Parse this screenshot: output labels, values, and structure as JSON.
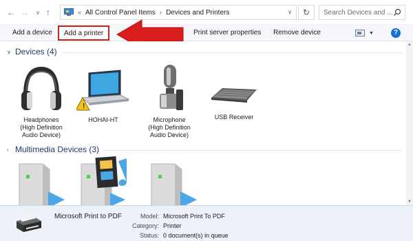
{
  "address_bar": {
    "crumbs": [
      "All Control Panel Items",
      "Devices and Printers"
    ],
    "separator": "«",
    "search_placeholder": "Search Devices and ..."
  },
  "command_bar": {
    "add_device": "Add a device",
    "add_printer": "Add a printer",
    "print_server": "Print server properties",
    "remove_device": "Remove device",
    "help": "?"
  },
  "groups": {
    "devices": {
      "title": "Devices (4)",
      "items": [
        {
          "label": "Headphones\n(High Definition\nAudio Device)",
          "icon": "headphones-icon"
        },
        {
          "label": "HOHAI-HT",
          "icon": "laptop-icon",
          "warning": true
        },
        {
          "label": "Microphone\n(High Definition\nAudio Device)",
          "icon": "microphone-icon"
        },
        {
          "label": "USB Receiver",
          "icon": "keyboard-icon"
        }
      ]
    },
    "multimedia": {
      "title": "Multimedia Devices (3)",
      "items": [
        {
          "icon": "media-server-icon"
        },
        {
          "icon": "media-server-icon"
        },
        {
          "icon": "media-server-icon"
        }
      ]
    }
  },
  "details": {
    "name": "Microsoft Print to PDF",
    "model_label": "Model:",
    "model": "Microsoft Print To PDF",
    "category_label": "Category:",
    "category": "Printer",
    "status_label": "Status:",
    "status": "0 document(s) in queue"
  },
  "colors": {
    "highlight_border": "#cf1f1f",
    "arrow": "#d91e1e",
    "group_title": "#1e3a6e",
    "details_bg": "#edf2f9"
  }
}
